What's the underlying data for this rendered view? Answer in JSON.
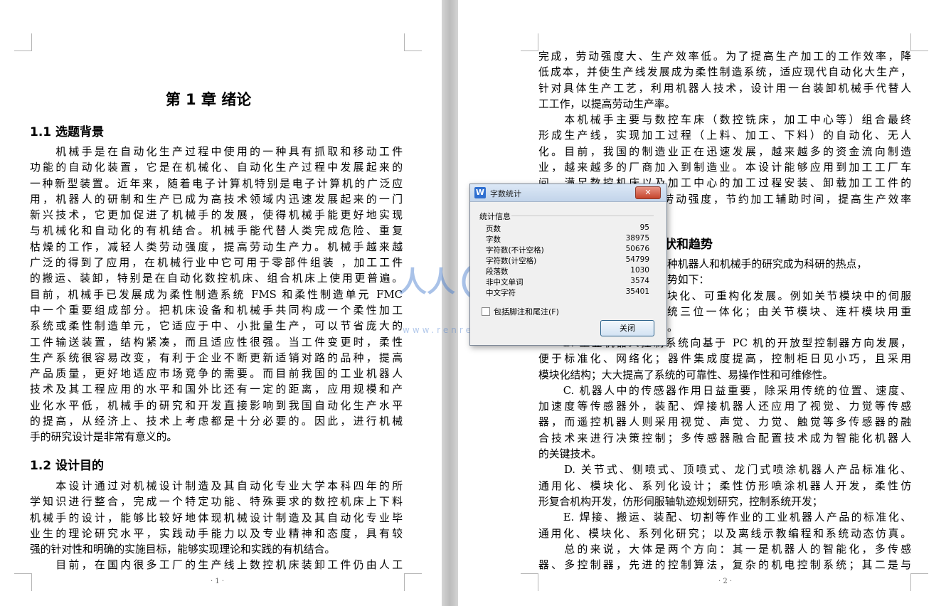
{
  "page1": {
    "chapter_title": "第 1 章  绪论",
    "section1_title": "1.1  选题背景",
    "section1_lines": [
      "　　机械手是在自动化生产过程中使用的一种具有抓取和移动工件",
      "功能的自动化装置，它是在机械化、自动化生产过程中发展起来的",
      "一种新型装置。近年来，随着电子计算机特别是电子计算机的广泛应",
      "用，机器人的研制和生产已成为高技术领域内迅速发展起来的一门",
      "新兴技术，它更加促进了机械手的发展，使得机械手能更好地实现",
      "与机械化和自动化的有机结合。机械手能代替人类完成危险、重复",
      "枯燥的工作，减轻人类劳动强度，提高劳动生产力。机械手越来越",
      "广泛的得到了应用，在机械行业中它可用于零部件组装 ，加工工件",
      "的搬运、装卸，特别是在自动化数控机床、组合机床上使用更普遍。",
      "目前，机械手已发展成为柔性制造系统 FMS 和柔性制造单元 FMC",
      "中一个重要组成部分。把机床设备和机械手共同构成一个柔性加工",
      "系统或柔性制造单元，它适应于中、小批量生产，可以节省庞大的",
      "工件输送装置，结构紧凑，而且适应性很强。当工件变更时，柔性",
      "生产系统很容易改变，有利于企业不断更新适销对路的品种，提高",
      "产品质量，更好地适应市场竞争的需要。而目前我国的工业机器人",
      "技术及其工程应用的水平和国外比还有一定的距离，应用规模和产",
      "业化水平低，机械手的研究和开发直接影响到我国自动化生产水平",
      "的提高，从经济上、技术上考虑都是十分必要的。因此，进行机械",
      "手的研究设计是非常有意义的。"
    ],
    "section2_title": "1.2  设计目的",
    "section2_lines": [
      "　　本设计通过对机械设计制造及其自动化专业大学本科四年的所",
      "学知识进行整合，完成一个特定功能、特殊要求的数控机床上下料",
      "机械手的设计，能够比较好地体现机械设计制造及其自动化专业毕",
      "业生的理论研究水平，实践动手能力以及专业精神和态度，具有较",
      "强的针对性和明确的实施目标，能够实现理论和实践的有机结合。",
      "　　目前，在国内很多工厂的生产线上数控机床装卸工件仍由人工"
    ],
    "page_number": "· 1 ·"
  },
  "page2": {
    "lines_top": [
      "完成，劳动强度大、生产效率低。为了提高生产加工的工作效率，降",
      "低成本，并使生产线发展成为柔性制造系统，适应现代自动化大生产，",
      "针对具体生产工艺，利用机器人技术，设计用一台装卸机械手代替人",
      "工工作，以提高劳动生产率。",
      "　　本机械手主要与数控车床（数控铣床，加工中心等）组合最终",
      "形成生产线，实现加工过程（上料、加工、下料）的自动化、无人",
      "化。目前，我国的制造业正在迅速发展，越来越多的资金流向制造",
      "业，越来越多的厂商加入到制造业。本设计能够应用到加工工厂车",
      "间，满足数控机床以及加工中心的加工过程安装、卸载加工工件的",
      "要求，从而减轻工人的劳动强度，节约加工辅助时间，提高生产效率",
      "。"
    ],
    "section_title_partial": "状和趋势",
    "frag_lines": [
      "种机器人和机械手的研究成为科研的热点，",
      "势如下：",
      "块化、可重构化发展。例如关节模块中的伺服",
      "统三位一体化；由关节模块、连杆模块用重",
      "。"
    ],
    "lines_bottom": [
      "　　B. 工业机器人控制系统向基于 PC 机的开放型控制器方向发展，",
      "便于标准化、网络化；器件集成度提高，控制柜日见小巧，且采用",
      "模块化结构；大大提高了系统的可靠性、易操作性和可维修性。",
      "　　C. 机器人中的传感器作用日益重要，除采用传统的位置、速度、",
      "加速度等传感器外，装配、焊接机器人还应用了视觉、力觉等传感",
      "器，而遥控机器人则采用视觉、声觉、力觉、触觉等多传感器的融",
      "合技术来进行决策控制；多传感器融合配置技术成为智能化机器人",
      "的关键技术。",
      "　　D. 关节式、侧喷式、顶喷式、龙门式喷涂机器人产品标准化、",
      "通用化、模块化、系列化设计；柔性仿形喷涂机器人开发，柔性仿",
      "形复合机构开发，仿形伺服轴轨迹规划研究，控制系统开发；",
      "　　E. 焊接、搬运、装配、切割等作业的工业机器人产品的标准化、",
      "通用化、模块化、系列化研究；以及离线示教编程和系统动态仿真。",
      "　　总的来说，大体是两个方向：其一是机器人的智能化，多传感",
      "器、多控制器，先进的控制算法，复杂的机电控制系统；其二是与"
    ],
    "page_number": "· 2 ·"
  },
  "dialog": {
    "title": "字数统计",
    "close_glyph": "✕",
    "app_icon": "W",
    "group_label": "统计信息",
    "stats": [
      {
        "label": "页数",
        "value": "95"
      },
      {
        "label": "字数",
        "value": "38975"
      },
      {
        "label": "字符数(不计空格)",
        "value": "50676"
      },
      {
        "label": "字符数(计空格)",
        "value": "54799"
      },
      {
        "label": "段落数",
        "value": "1030"
      },
      {
        "label": "非中文单词",
        "value": "3574"
      },
      {
        "label": "中文字符",
        "value": "35401"
      }
    ],
    "checkbox_label": "包括脚注和尾注(F)",
    "checkbox_checked": false,
    "button_label": "关闭"
  },
  "watermark": {
    "chars": "人人文库",
    "url": "www.renrendoc.com"
  }
}
